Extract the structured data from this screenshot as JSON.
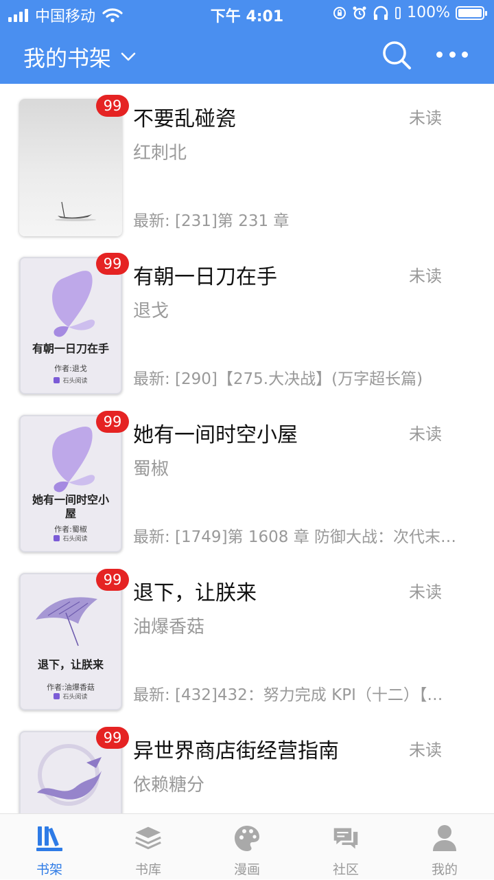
{
  "status_bar": {
    "carrier": "中国移动",
    "time": "下午 4:01",
    "battery": "100%"
  },
  "header": {
    "title": "我的书架",
    "search_icon": "search-icon",
    "more_icon": "more-icon"
  },
  "books": [
    {
      "title": "不要乱碰瓷",
      "author": "红刺北",
      "badge": "99",
      "status": "未读",
      "latest": "最新: [231]第 231 章"
    },
    {
      "title": "有朝一日刀在手",
      "author": "退戈",
      "badge": "99",
      "status": "未读",
      "latest": "最新: [290]【275.大决战】(万字超长篇)",
      "cover": {
        "title": "有朝一日刀在手",
        "author": "作者:退戈",
        "publisher": "石头阅读"
      }
    },
    {
      "title": "她有一间时空小屋",
      "author": "蜀椒",
      "badge": "99",
      "status": "未读",
      "latest": "最新: [1749]第 1608 章 防御大战：次代末…",
      "cover": {
        "title": "她有一间时空小屋",
        "author": "作者:蜀椒",
        "publisher": "石头阅读"
      }
    },
    {
      "title": "退下，让朕来",
      "author": "油爆香菇",
      "badge": "99",
      "status": "未读",
      "latest": "最新: [432]432：努力完成 KPI（十二）【…",
      "cover": {
        "title": "退下，让朕来",
        "author": "作者:油爆香菇",
        "publisher": "石头阅读"
      }
    },
    {
      "title": "异世界商店街经营指南",
      "author": "依赖糖分",
      "badge": "99",
      "status": "未读",
      "latest": ""
    }
  ],
  "tabs": [
    {
      "label": "书架",
      "icon": "bookshelf-icon",
      "active": true
    },
    {
      "label": "书库",
      "icon": "library-icon",
      "active": false
    },
    {
      "label": "漫画",
      "icon": "comics-icon",
      "active": false
    },
    {
      "label": "社区",
      "icon": "community-icon",
      "active": false
    },
    {
      "label": "我的",
      "icon": "profile-icon",
      "active": false
    }
  ],
  "colors": {
    "header_bg": "#4a8ff0",
    "badge_bg": "#e52323",
    "tab_active": "#2e7be6",
    "tab_inactive": "#999999"
  }
}
